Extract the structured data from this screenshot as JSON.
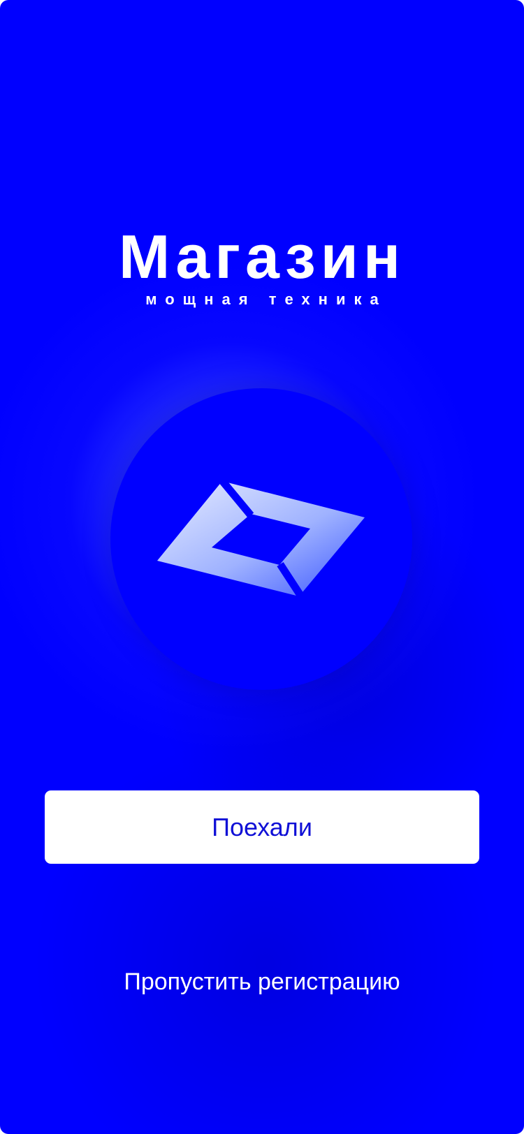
{
  "app": {
    "title": "Магазин",
    "tagline": "мощная техника"
  },
  "logo": {
    "icon": "rhombus-logo-icon"
  },
  "actions": {
    "primary_label": "Поехали",
    "skip_label": "Пропустить регистрацию"
  },
  "colors": {
    "background": "#0000FF",
    "button_background": "#FFFFFF",
    "button_text": "#1010D6",
    "text": "#FFFFFF"
  }
}
